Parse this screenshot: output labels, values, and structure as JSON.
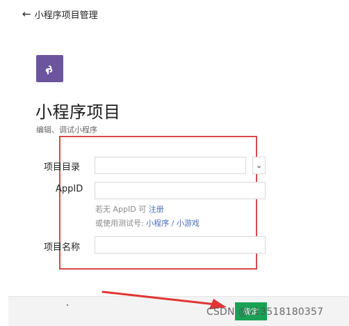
{
  "header": {
    "back_icon": "arrow-left-icon",
    "title": "小程序项目管理"
  },
  "logo": {
    "icon": "mini-program-icon",
    "color": "#6b559e"
  },
  "project": {
    "title": "小程序项目",
    "subtitle": "编辑、调试小程序"
  },
  "form": {
    "directory": {
      "label": "项目目录",
      "value": "",
      "button_icon": "chevron-down-icon"
    },
    "appid": {
      "label": "AppID",
      "value": "",
      "hint_prefix": "若无 AppID 可",
      "hint_register": "注册",
      "hint_test_prefix": "或使用测试号:",
      "hint_miniprogram": "小程序",
      "hint_sep": "/",
      "hint_minigame": "小游戏"
    },
    "name": {
      "label": "项目名称",
      "value": ""
    }
  },
  "footer": {
    "confirm_label": "确定",
    "confirm_color": "#19a155"
  },
  "annotation": {
    "box_color": "#d84848",
    "arrow_color": "#e03535"
  },
  "watermark": "CSDN @v13518180357"
}
